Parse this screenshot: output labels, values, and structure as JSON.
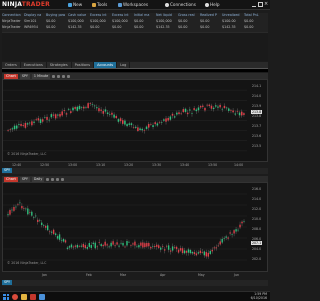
{
  "app": {
    "logo_part1": "NINJA",
    "logo_part2": "TRADER",
    "menu": [
      {
        "label": "New",
        "icon": "new-icon",
        "color": "#4aa3df"
      },
      {
        "label": "Tools",
        "icon": "tools-icon",
        "color": "#d9a441"
      },
      {
        "label": "Workspaces",
        "icon": "workspaces-icon",
        "color": "#5b9bd5"
      },
      {
        "label": "Connections",
        "icon": "connections-icon",
        "color": "#e0e0e0"
      },
      {
        "label": "Help",
        "icon": "help-icon",
        "color": "#e0e0e0"
      }
    ]
  },
  "accounts": {
    "headers": [
      "Connection",
      "Display na",
      "Buying pow",
      "Cash value",
      "Excess int",
      "Excess int",
      "Initial ma",
      "Net liquid",
      "Gross real",
      "Realized P",
      "Unrealized",
      "Total PnL"
    ],
    "rows": [
      [
        "NinjaTrader",
        "Sim101",
        "$0.00",
        "$100,000",
        "$100,000",
        "$100,000",
        "$0.00",
        "$100,000",
        "$0.00",
        "$0.00",
        "$100.00",
        "$0.00"
      ],
      [
        "NinjaTrader",
        "WR6954",
        "$0.00",
        "$142.35",
        "$0.00",
        "$0.00",
        "$0.00",
        "$142.35",
        "$0.00",
        "$0.00",
        "$142.35",
        "$0.00"
      ]
    ]
  },
  "tabs": [
    "Orders",
    "Executions",
    "Strategies",
    "Positions",
    "Accounts",
    "Log"
  ],
  "active_tab": "Accounts",
  "chart1": {
    "label": "Chart",
    "instrument": "SPY",
    "interval": "1 Minute",
    "copyright": "© 2016 NinjaTrader, LLC",
    "price_tag": "213.8",
    "y_labels": [
      "214.1",
      "214.0",
      "213.9",
      "213.8",
      "213.7",
      "213.6",
      "213.5"
    ],
    "x_labels": [
      "12:40",
      "12:50",
      "13:00",
      "13:10",
      "13:20",
      "13:30",
      "13:40",
      "13:50",
      "14:00"
    ],
    "subtab": "SPY"
  },
  "chart2": {
    "label": "Chart",
    "instrument": "SPY",
    "interval": "Daily",
    "copyright": "© 2016 NinjaTrader, LLC",
    "price_tag": "207.1",
    "y_labels": [
      "216.0",
      "214.0",
      "212.0",
      "210.0",
      "208.0",
      "206.0",
      "204.0",
      "202.0"
    ],
    "x_labels": [
      "Jan",
      "Feb",
      "Mar",
      "Apr",
      "May",
      "Jun"
    ],
    "subtab": "SPY"
  },
  "taskbar": {
    "time": "1:59 PM",
    "date": "6/10/2016",
    "apps": [
      {
        "icon": "chrome-icon",
        "color": "#d94b3b"
      },
      {
        "icon": "explorer-icon",
        "color": "#e2b340"
      },
      {
        "icon": "ninjatrader-icon",
        "color": "#c4372c"
      },
      {
        "icon": "app-icon",
        "color": "#4a90d9"
      }
    ]
  },
  "colors": {
    "up": "#2ec27e",
    "down": "#e0404a",
    "accent": "#1f6f9a",
    "brand": "#c4372c"
  }
}
